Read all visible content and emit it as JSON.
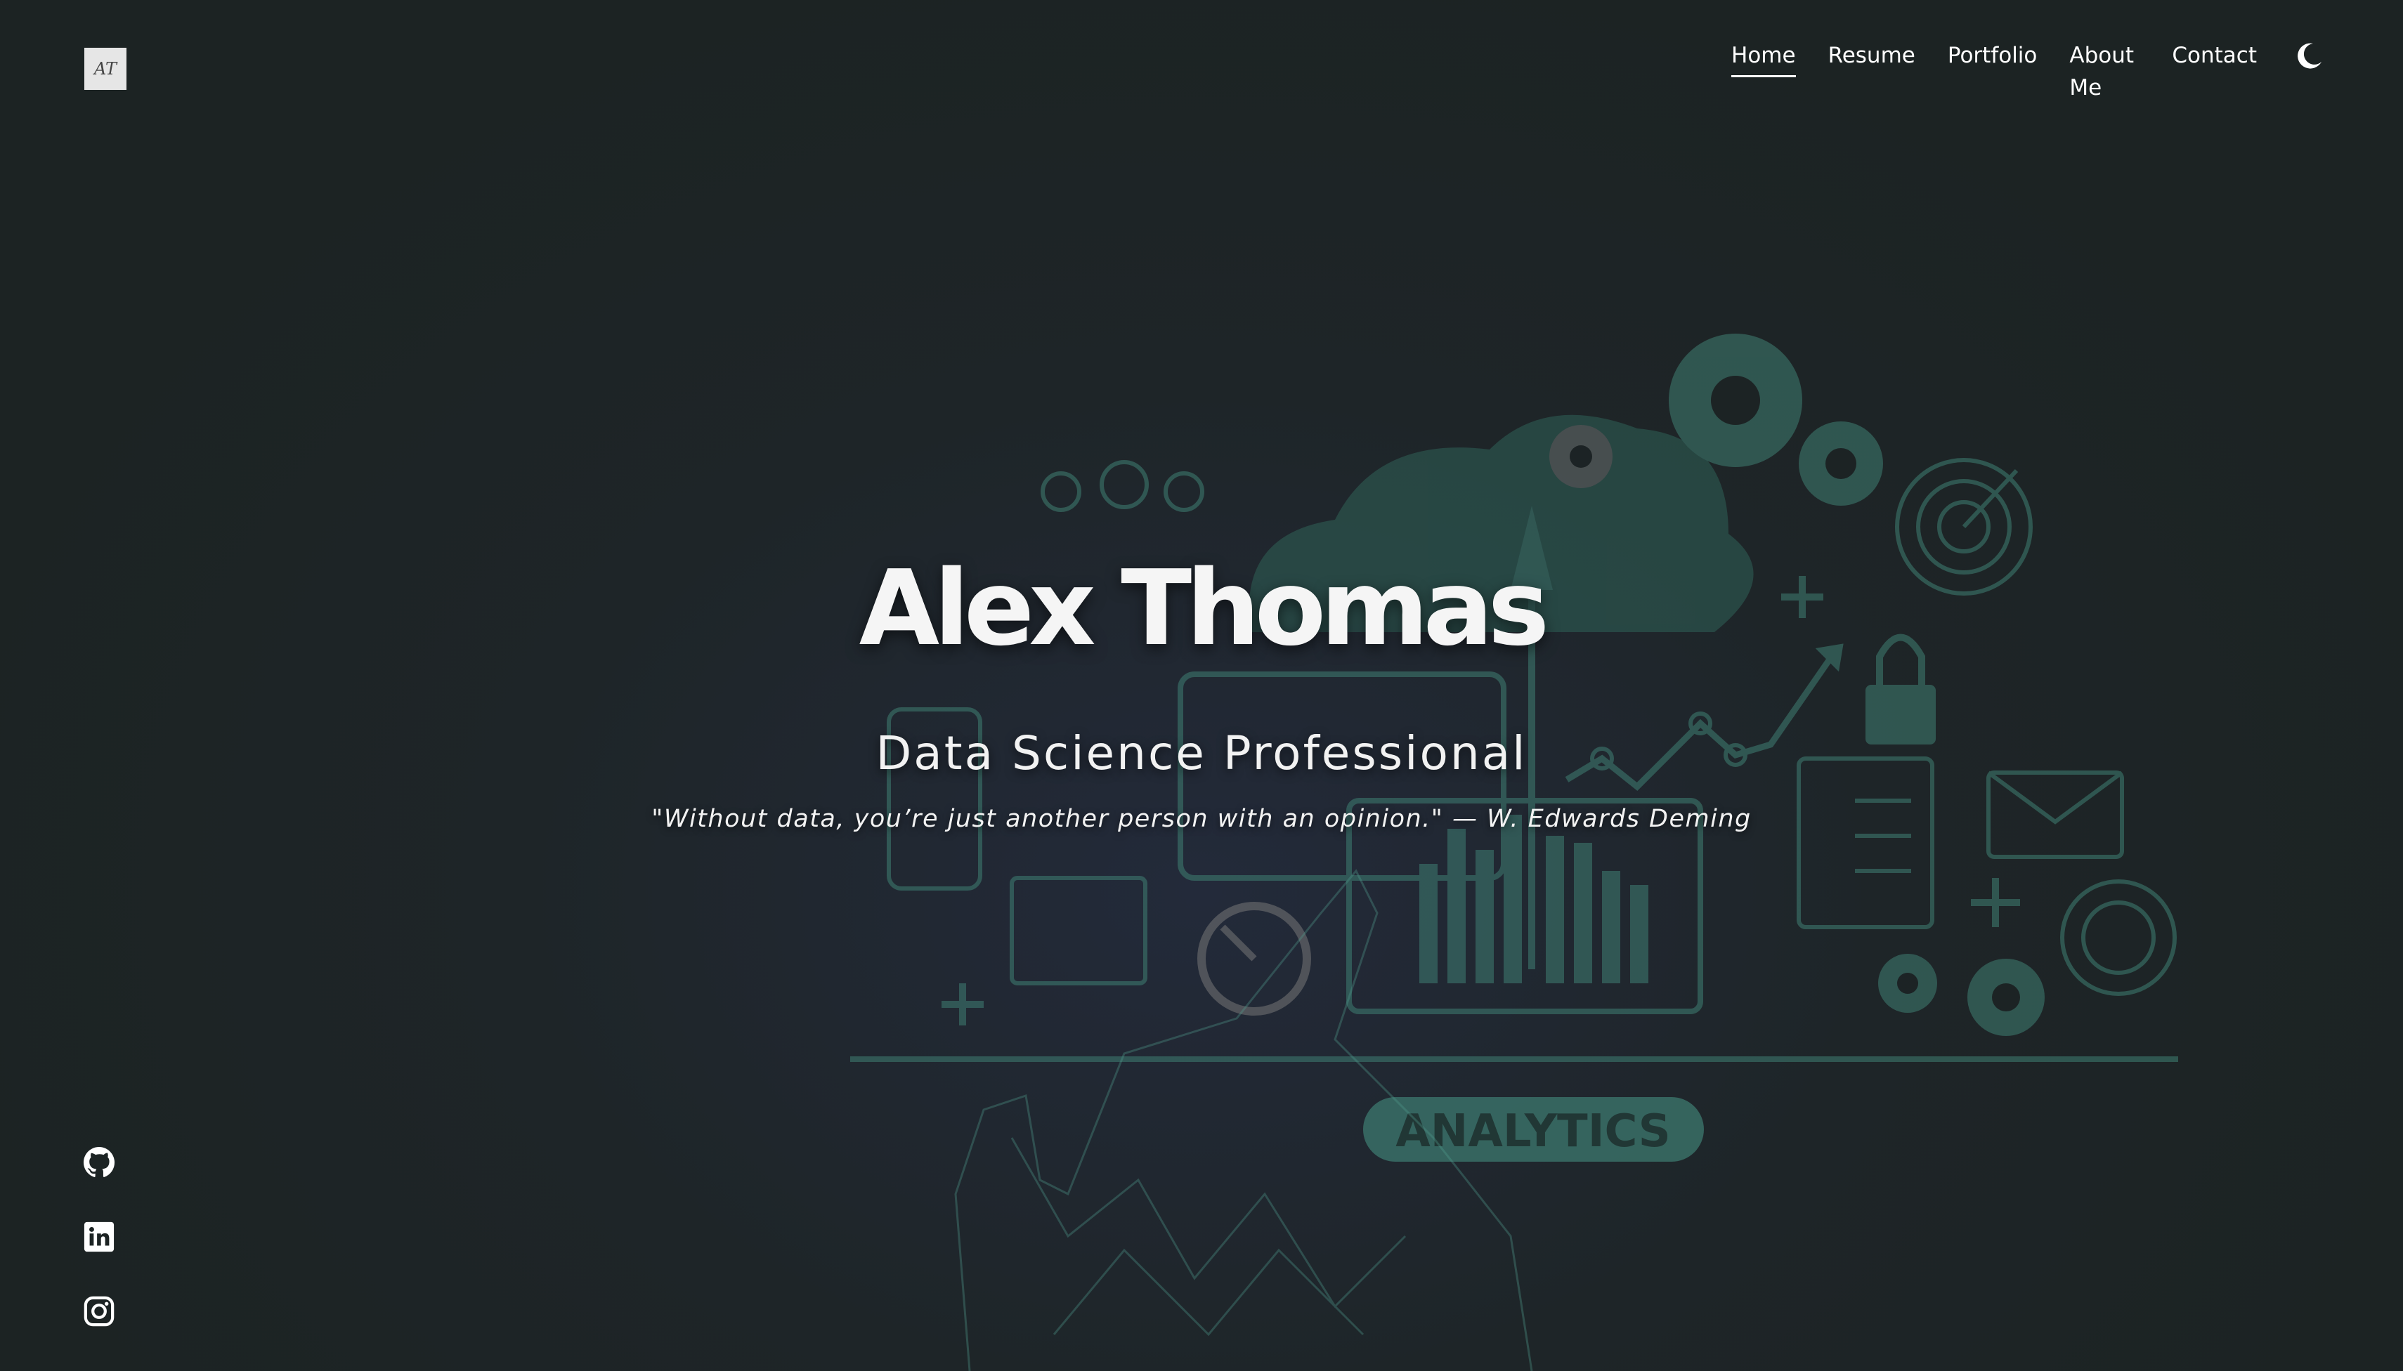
{
  "logo": {
    "text": "AT"
  },
  "nav": {
    "items": [
      {
        "label": "Home",
        "active": true
      },
      {
        "label": "Resume",
        "active": false
      },
      {
        "label": "Portfolio",
        "active": false
      },
      {
        "label": "About Me",
        "active": false
      },
      {
        "label": "Contact",
        "active": false
      }
    ],
    "theme_toggle_icon": "moon-icon"
  },
  "hero": {
    "name": "Alex Thomas",
    "subtitle": "Data Science Professional",
    "quote": "\"Without data, you’re just another person with an opinion.\" — W. Edwards Deming",
    "illustration_label": "ANALYTICS"
  },
  "social": [
    {
      "name": "github",
      "icon": "github-icon"
    },
    {
      "name": "linkedin",
      "icon": "linkedin-icon"
    },
    {
      "name": "instagram",
      "icon": "instagram-icon"
    }
  ],
  "colors": {
    "background": "#1c2323",
    "accent": "#3f7f73",
    "text": "#ffffff"
  }
}
